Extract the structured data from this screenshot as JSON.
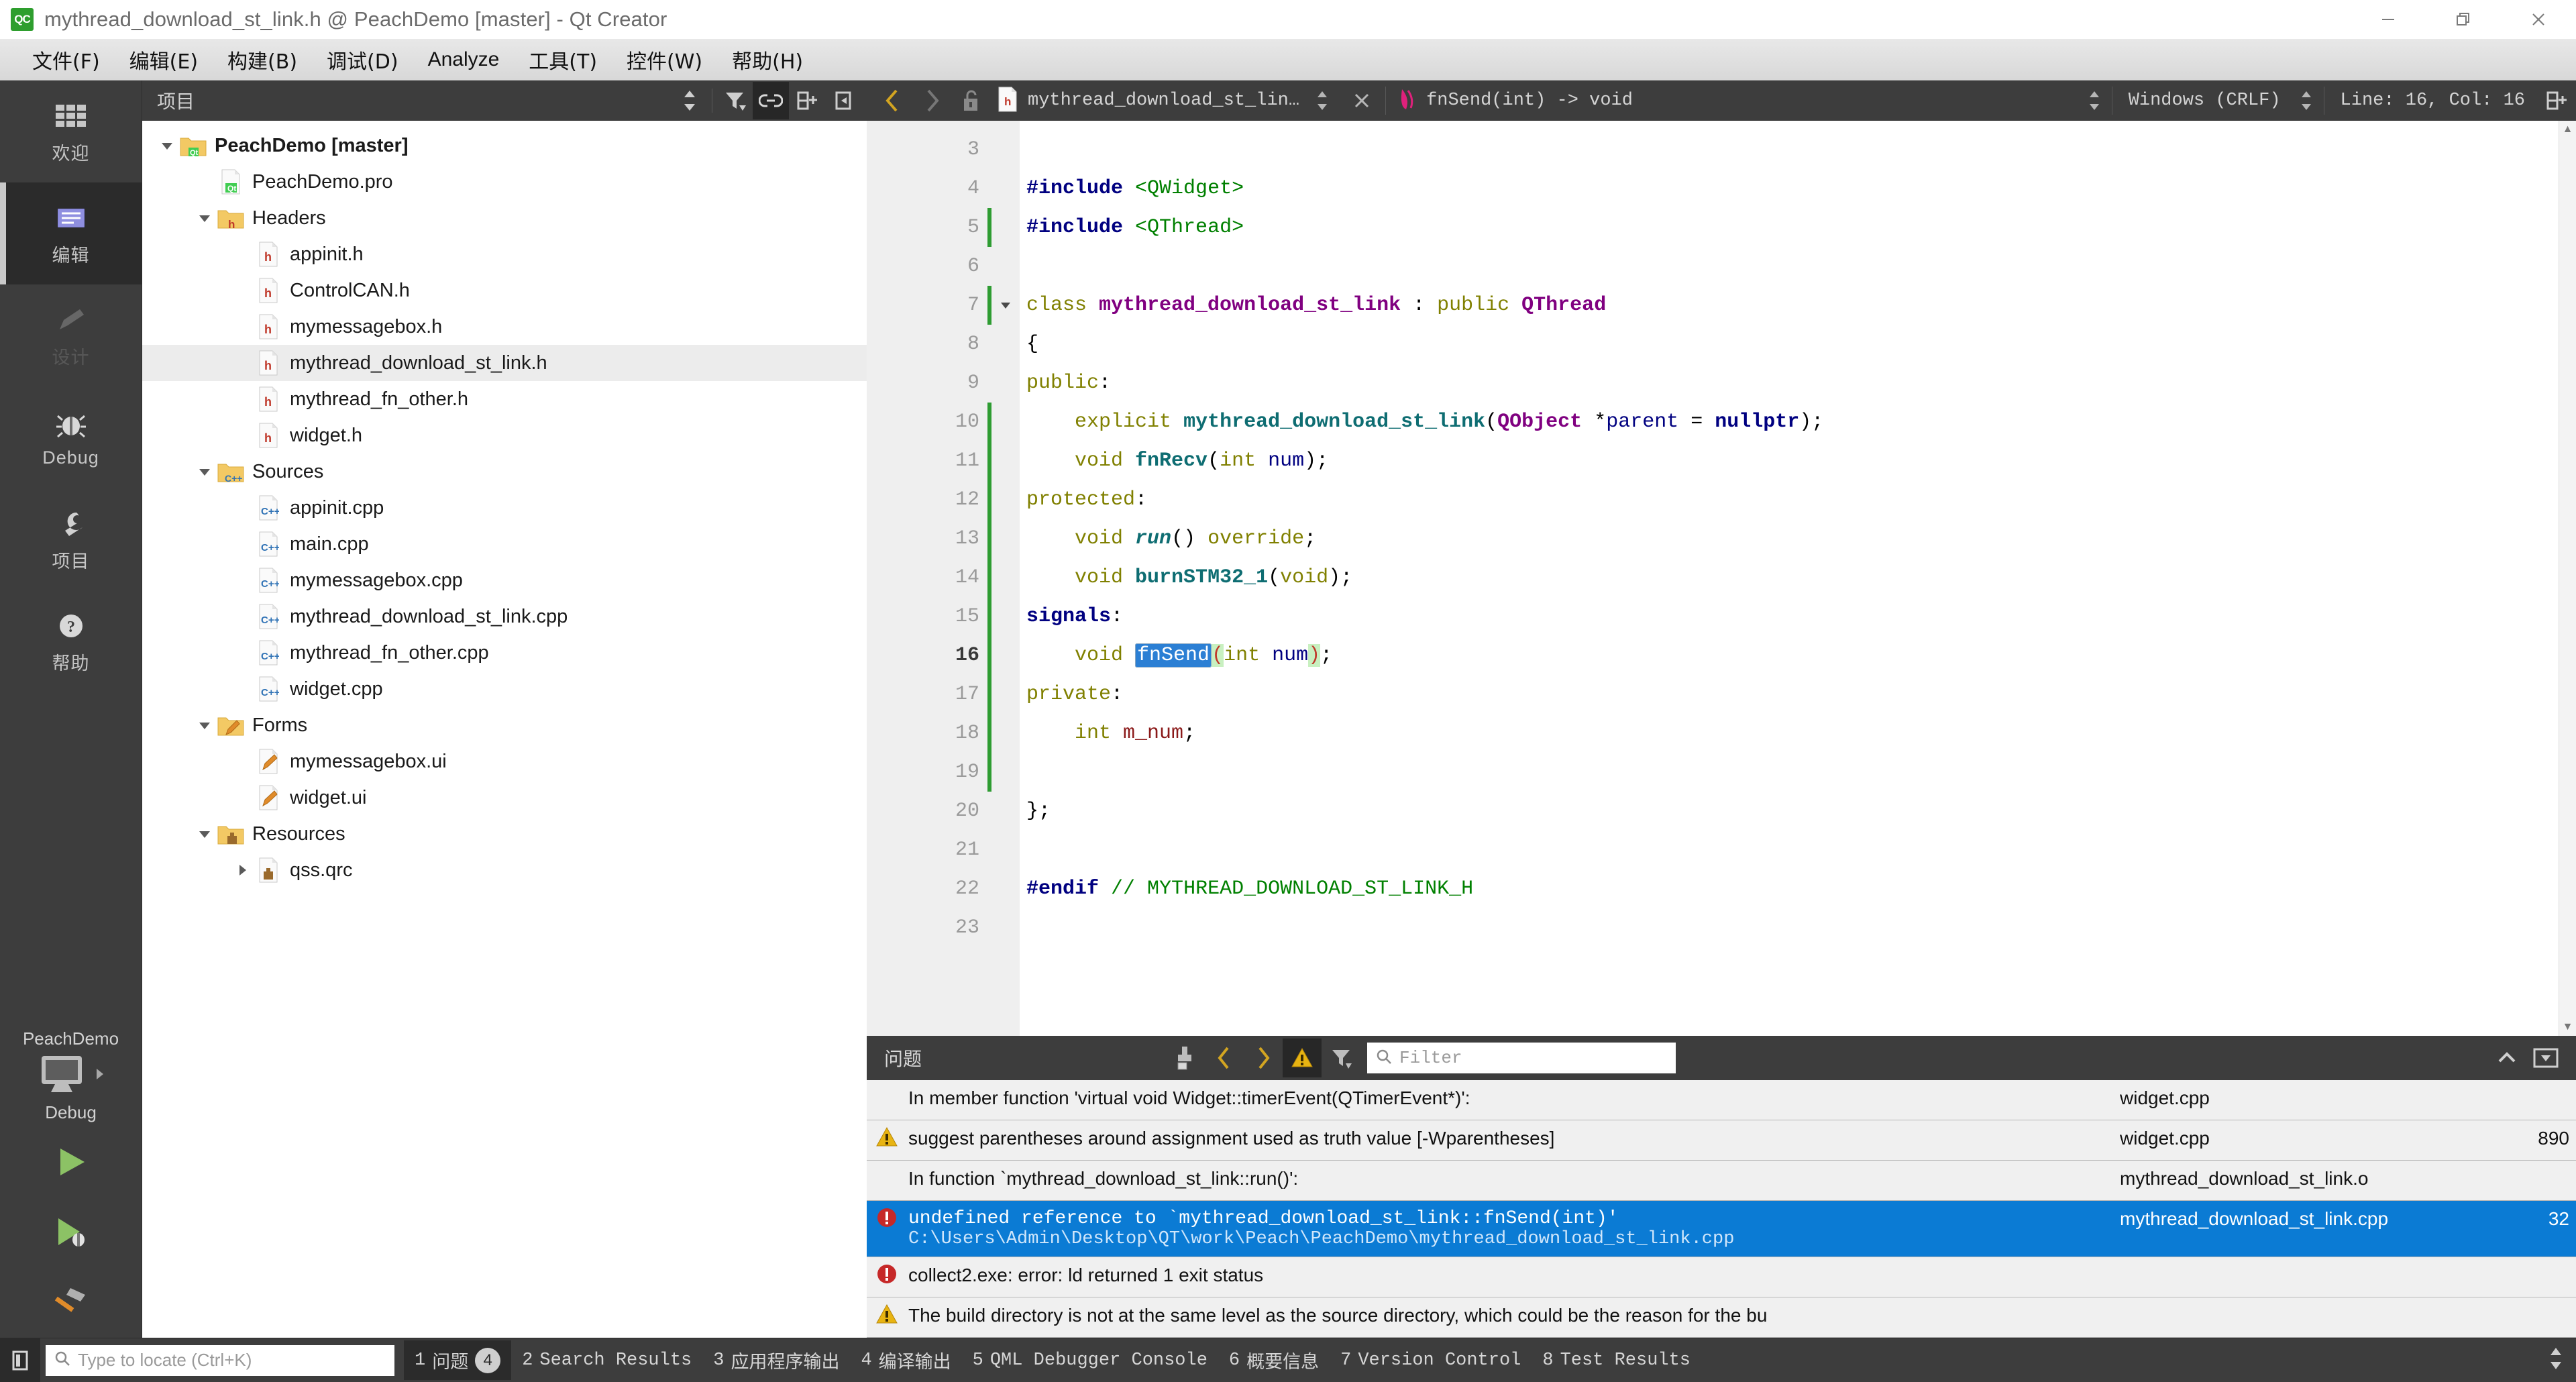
{
  "window": {
    "title": "mythread_download_st_link.h @ PeachDemo [master] - Qt Creator",
    "app_icon": "qt-creator-icon",
    "minimize": "minimize-icon",
    "maximize": "restore-icon",
    "close": "close-icon"
  },
  "menubar": {
    "items": [
      {
        "label": "文件(F)",
        "name": "menu-file"
      },
      {
        "label": "编辑(E)",
        "name": "menu-edit"
      },
      {
        "label": "构建(B)",
        "name": "menu-build"
      },
      {
        "label": "调试(D)",
        "name": "menu-debug"
      },
      {
        "label": "Analyze",
        "name": "menu-analyze"
      },
      {
        "label": "工具(T)",
        "name": "menu-tools"
      },
      {
        "label": "控件(W)",
        "name": "menu-window"
      },
      {
        "label": "帮助(H)",
        "name": "menu-help"
      }
    ]
  },
  "modebar": {
    "modes": [
      {
        "label": "欢迎",
        "icon": "grid-icon",
        "state": "normal"
      },
      {
        "label": "编辑",
        "icon": "edit-lines-icon",
        "state": "active"
      },
      {
        "label": "设计",
        "icon": "pencil-icon",
        "state": "disabled"
      },
      {
        "label": "Debug",
        "icon": "bug-icon",
        "state": "normal"
      },
      {
        "label": "项目",
        "icon": "wrench-icon",
        "state": "normal"
      },
      {
        "label": "帮助",
        "icon": "question-circle-icon",
        "state": "normal"
      }
    ],
    "kit": {
      "project": "PeachDemo",
      "build_config": "Debug",
      "selector_icon": "desktop-icon",
      "arrow_icon": "chevron-right-icon",
      "run_icon": "run-play-icon",
      "debug_icon": "run-debug-icon",
      "build_icon": "hammer-icon"
    }
  },
  "sidebar": {
    "title": "项目",
    "tools": [
      {
        "name": "sync-spin",
        "icon": "spinner-arrows-icon",
        "active": false
      },
      {
        "name": "filter-tree",
        "icon": "filter-icon",
        "active": false
      },
      {
        "name": "sync-with-editor",
        "icon": "link-icon",
        "active": true
      },
      {
        "name": "split-pane",
        "icon": "split-add-icon",
        "active": false
      },
      {
        "name": "close-pane",
        "icon": "close-sidebar-icon",
        "active": false
      }
    ],
    "tree": [
      {
        "label": "PeachDemo [master]",
        "depth": 0,
        "icon": "folder-qt-icon",
        "twisty": "down",
        "bold": true,
        "selected": false
      },
      {
        "label": "PeachDemo.pro",
        "depth": 1,
        "icon": "file-qt-icon",
        "twisty": "",
        "bold": false,
        "selected": false
      },
      {
        "label": "Headers",
        "depth": 1,
        "icon": "folder-h-icon",
        "twisty": "down",
        "bold": false,
        "selected": false
      },
      {
        "label": "appinit.h",
        "depth": 2,
        "icon": "file-h-icon",
        "twisty": "",
        "bold": false,
        "selected": false
      },
      {
        "label": "ControlCAN.h",
        "depth": 2,
        "icon": "file-h-icon",
        "twisty": "",
        "bold": false,
        "selected": false
      },
      {
        "label": "mymessagebox.h",
        "depth": 2,
        "icon": "file-h-icon",
        "twisty": "",
        "bold": false,
        "selected": false
      },
      {
        "label": "mythread_download_st_link.h",
        "depth": 2,
        "icon": "file-h-icon",
        "twisty": "",
        "bold": false,
        "selected": true
      },
      {
        "label": "mythread_fn_other.h",
        "depth": 2,
        "icon": "file-h-icon",
        "twisty": "",
        "bold": false,
        "selected": false
      },
      {
        "label": "widget.h",
        "depth": 2,
        "icon": "file-h-icon",
        "twisty": "",
        "bold": false,
        "selected": false
      },
      {
        "label": "Sources",
        "depth": 1,
        "icon": "folder-cpp-icon",
        "twisty": "down",
        "bold": false,
        "selected": false
      },
      {
        "label": "appinit.cpp",
        "depth": 2,
        "icon": "file-cpp-icon",
        "twisty": "",
        "bold": false,
        "selected": false
      },
      {
        "label": "main.cpp",
        "depth": 2,
        "icon": "file-cpp-icon",
        "twisty": "",
        "bold": false,
        "selected": false
      },
      {
        "label": "mymessagebox.cpp",
        "depth": 2,
        "icon": "file-cpp-icon",
        "twisty": "",
        "bold": false,
        "selected": false
      },
      {
        "label": "mythread_download_st_link.cpp",
        "depth": 2,
        "icon": "file-cpp-icon",
        "twisty": "",
        "bold": false,
        "selected": false
      },
      {
        "label": "mythread_fn_other.cpp",
        "depth": 2,
        "icon": "file-cpp-icon",
        "twisty": "",
        "bold": false,
        "selected": false
      },
      {
        "label": "widget.cpp",
        "depth": 2,
        "icon": "file-cpp-icon",
        "twisty": "",
        "bold": false,
        "selected": false
      },
      {
        "label": "Forms",
        "depth": 1,
        "icon": "folder-ui-icon",
        "twisty": "down",
        "bold": false,
        "selected": false
      },
      {
        "label": "mymessagebox.ui",
        "depth": 2,
        "icon": "file-ui-icon",
        "twisty": "",
        "bold": false,
        "selected": false
      },
      {
        "label": "widget.ui",
        "depth": 2,
        "icon": "file-ui-icon",
        "twisty": "",
        "bold": false,
        "selected": false
      },
      {
        "label": "Resources",
        "depth": 1,
        "icon": "folder-qrc-icon",
        "twisty": "down",
        "bold": false,
        "selected": false
      },
      {
        "label": "qss.qrc",
        "depth": 2,
        "icon": "file-qrc-icon",
        "twisty": "right",
        "bold": false,
        "selected": false
      }
    ]
  },
  "editor_toolbar": {
    "back_icon": "chevron-left-icon",
    "forward_icon": "chevron-right-icon",
    "lock_icon": "unlocked-icon",
    "file_icon": "file-h-icon",
    "open_file": "mythread_download_st_lin…",
    "close_icon": "close-document-icon",
    "symbol_icon": "signal-icon",
    "symbol": "fnSend(int) -> void",
    "line_ending": "Windows (CRLF)",
    "cursor_position": "Line: 16, Col: 16",
    "split_icon": "split-editor-icon"
  },
  "editor": {
    "first_line": 3,
    "lines": [
      {
        "n": 3,
        "changed": false,
        "fold": "",
        "text": ""
      },
      {
        "n": 4,
        "changed": false,
        "fold": "",
        "text": "#include <QWidget>"
      },
      {
        "n": 5,
        "changed": true,
        "fold": "",
        "text": "#include <QThread>"
      },
      {
        "n": 6,
        "changed": false,
        "fold": "",
        "text": ""
      },
      {
        "n": 7,
        "changed": true,
        "fold": "down",
        "text": "class mythread_download_st_link : public QThread"
      },
      {
        "n": 8,
        "changed": false,
        "fold": "",
        "text": "{"
      },
      {
        "n": 9,
        "changed": false,
        "fold": "",
        "text": "public:"
      },
      {
        "n": 10,
        "changed": true,
        "fold": "",
        "text": "    explicit mythread_download_st_link(QObject *parent = nullptr);"
      },
      {
        "n": 11,
        "changed": true,
        "fold": "",
        "text": "    void fnRecv(int num);"
      },
      {
        "n": 12,
        "changed": true,
        "fold": "",
        "text": "protected:"
      },
      {
        "n": 13,
        "changed": true,
        "fold": "",
        "text": "    void run() override;"
      },
      {
        "n": 14,
        "changed": true,
        "fold": "",
        "text": "    void burnSTM32_1(void);"
      },
      {
        "n": 15,
        "changed": true,
        "fold": "",
        "text": "signals:"
      },
      {
        "n": 16,
        "changed": true,
        "fold": "",
        "text": "    void fnSend(int num);",
        "current": true
      },
      {
        "n": 17,
        "changed": true,
        "fold": "",
        "text": "private:"
      },
      {
        "n": 18,
        "changed": true,
        "fold": "",
        "text": "    int m_num;"
      },
      {
        "n": 19,
        "changed": true,
        "fold": "",
        "text": ""
      },
      {
        "n": 20,
        "changed": false,
        "fold": "",
        "text": "};"
      },
      {
        "n": 21,
        "changed": false,
        "fold": "",
        "text": ""
      },
      {
        "n": 22,
        "changed": false,
        "fold": "",
        "text": "#endif // MYTHREAD_DOWNLOAD_ST_LINK_H"
      },
      {
        "n": 23,
        "changed": false,
        "fold": "",
        "text": ""
      }
    ],
    "selection": "fnSend"
  },
  "issues_panel": {
    "title": "问题",
    "tools": [
      {
        "name": "copy-issue",
        "icon": "copy-icon",
        "active": false
      },
      {
        "name": "previous-issue",
        "icon": "chevron-left-icon",
        "active": false
      },
      {
        "name": "next-issue",
        "icon": "chevron-right-icon",
        "active": false
      },
      {
        "name": "toggle-warnings",
        "icon": "warning-icon",
        "active": true
      },
      {
        "name": "filter-issues",
        "icon": "filter-icon",
        "active": false
      }
    ],
    "filter_placeholder": "Filter",
    "filter_value": "",
    "search_icon": "search-icon",
    "collapse_icon": "chevron-up-icon",
    "maximize_icon": "chevron-down-box-icon",
    "rows": [
      {
        "severity": "none",
        "description": "In member function 'virtual void Widget::timerEvent(QTimerEvent*)':",
        "detail": "",
        "file": "widget.cpp",
        "line": "",
        "selected": false,
        "mono": false
      },
      {
        "severity": "warning",
        "description": "suggest parentheses around assignment used as truth value [-Wparentheses]",
        "detail": "",
        "file": "widget.cpp",
        "line": "890",
        "selected": false,
        "mono": false
      },
      {
        "severity": "none",
        "description": "In function `mythread_download_st_link::run()':",
        "detail": "",
        "file": "mythread_download_st_link.o",
        "line": "",
        "selected": false,
        "mono": false
      },
      {
        "severity": "error",
        "description": "undefined reference to `mythread_download_st_link::fnSend(int)'",
        "detail": "C:\\Users\\Admin\\Desktop\\QT\\work\\Peach\\PeachDemo\\mythread_download_st_link.cpp",
        "file": "mythread_download_st_link.cpp",
        "line": "32",
        "selected": true,
        "mono": true
      },
      {
        "severity": "error",
        "description": "collect2.exe: error: ld returned 1 exit status",
        "detail": "",
        "file": "",
        "line": "",
        "selected": false,
        "mono": false
      },
      {
        "severity": "warning",
        "description": "The build directory is not at the same level as the source directory, which could be the reason for the bu",
        "detail": "",
        "file": "",
        "line": "",
        "selected": false,
        "mono": false
      }
    ]
  },
  "statusbar": {
    "sidebar_toggle_icon": "sidebar-toggle-icon",
    "locator_placeholder": "Type to locate (Ctrl+K)",
    "locator_value": "",
    "locator_icon": "search-icon",
    "tabs": [
      {
        "num": "1",
        "label": "问题",
        "badge": "4",
        "active": true
      },
      {
        "num": "2",
        "label": "Search Results",
        "badge": "",
        "active": false
      },
      {
        "num": "3",
        "label": "应用程序输出",
        "badge": "",
        "active": false
      },
      {
        "num": "4",
        "label": "编译输出",
        "badge": "",
        "active": false
      },
      {
        "num": "5",
        "label": "QML Debugger Console",
        "badge": "",
        "active": false
      },
      {
        "num": "6",
        "label": "概要信息",
        "badge": "",
        "active": false
      },
      {
        "num": "7",
        "label": "Version Control",
        "badge": "",
        "active": false
      },
      {
        "num": "8",
        "label": "Test Results",
        "badge": "",
        "active": false
      }
    ],
    "more_icon": "spinner-arrows-icon"
  },
  "colors": {
    "accent_blue": "#0b7bd4",
    "selection_blue": "#2b7fd4",
    "warning_yellow": "#e8b412",
    "error_red": "#c62828",
    "chrome_dark": "#3d3d3d",
    "chrome_darker": "#2b2b2b",
    "run_green": "#8cc265"
  }
}
